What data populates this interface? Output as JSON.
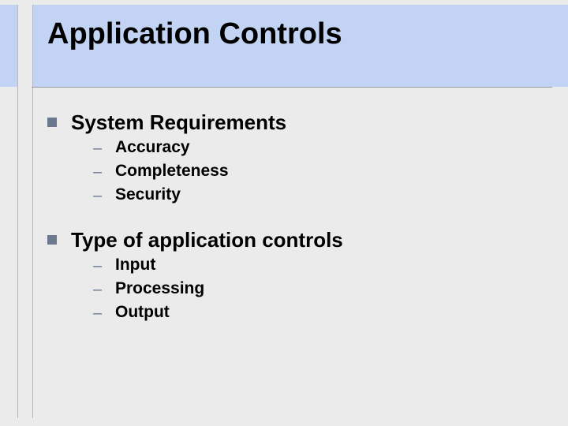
{
  "title": "Application Controls",
  "sections": [
    {
      "heading": "System Requirements",
      "items": [
        "Accuracy",
        "Completeness",
        "Security"
      ]
    },
    {
      "heading": "Type of application controls",
      "items": [
        "Input",
        "Processing",
        "Output"
      ]
    }
  ]
}
